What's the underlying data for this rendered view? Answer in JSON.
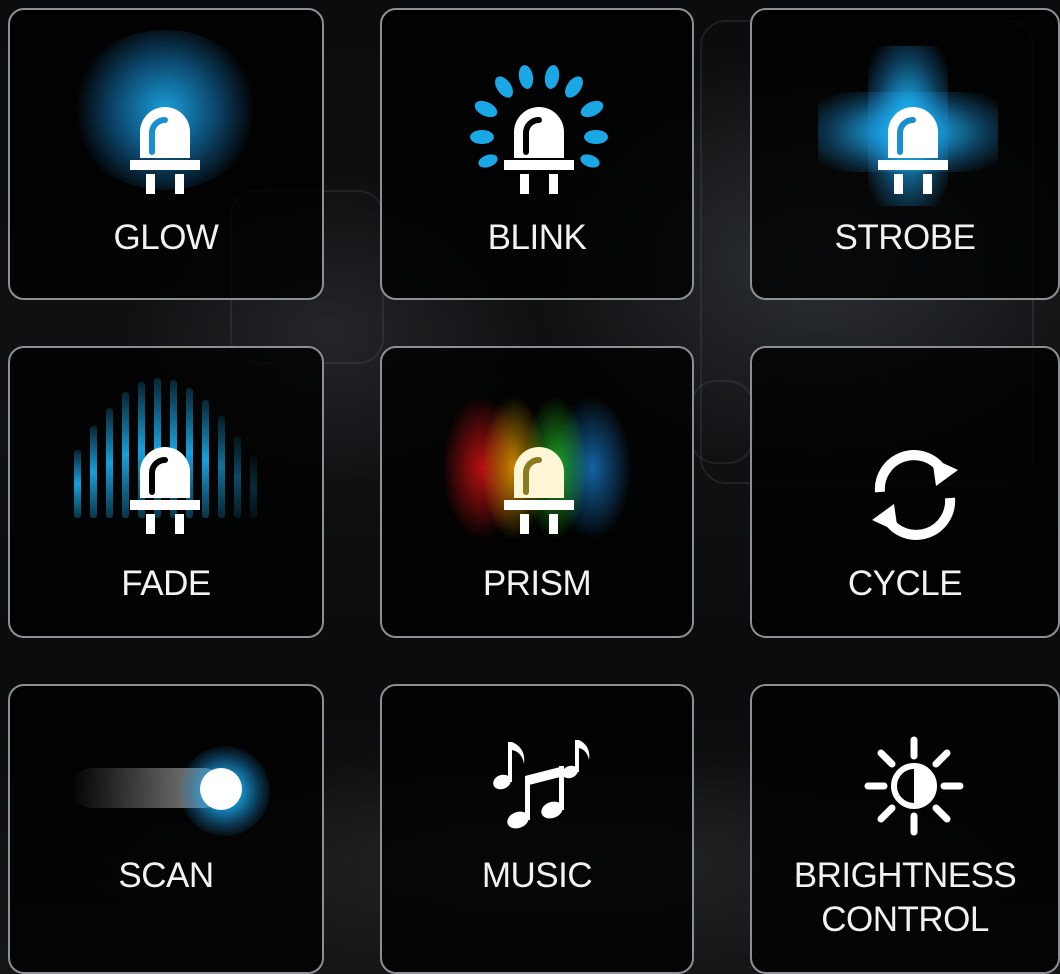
{
  "colors": {
    "accent_blue": "#1aa7e6",
    "tile_border": "#8c8f93",
    "label": "#f2f2f2"
  },
  "modes": [
    {
      "label": "GLOW",
      "icon": "led-bulb-glow-icon"
    },
    {
      "label": "BLINK",
      "icon": "led-bulb-blink-icon"
    },
    {
      "label": "STROBE",
      "icon": "led-bulb-strobe-icon"
    },
    {
      "label": "FADE",
      "icon": "led-bulb-fade-icon"
    },
    {
      "label": "PRISM",
      "icon": "led-bulb-prism-icon"
    },
    {
      "label": "CYCLE",
      "icon": "cycle-arrows-icon"
    },
    {
      "label": "SCAN",
      "icon": "scan-dot-icon"
    },
    {
      "label": "MUSIC",
      "icon": "music-notes-icon"
    },
    {
      "label_line1": "BRIGHTNESS",
      "label_line2": "CONTROL",
      "icon": "brightness-sun-icon"
    }
  ]
}
